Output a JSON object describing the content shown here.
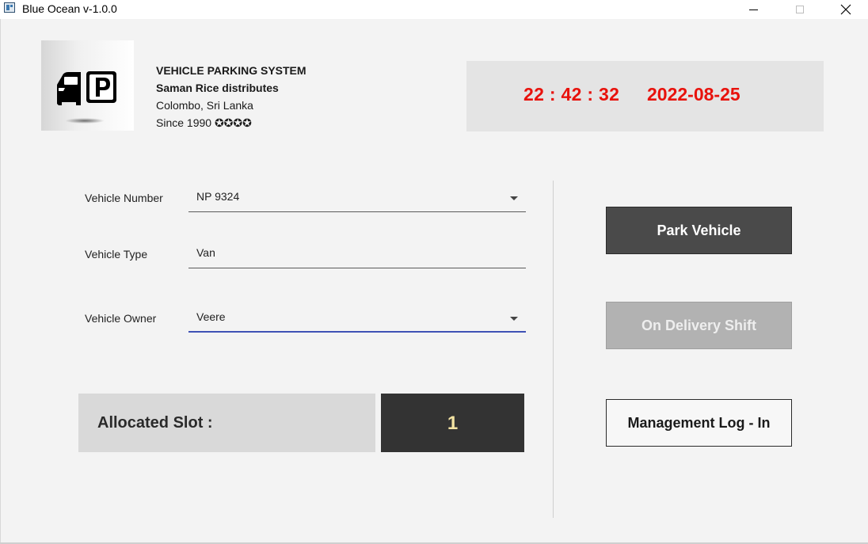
{
  "window": {
    "title": "Blue Ocean v-1.0.0"
  },
  "company": {
    "system_name": "VEHICLE PARKING SYSTEM",
    "name": "Saman Rice distributes",
    "location": "Colombo, Sri Lanka",
    "since": "Since 1990 ✪✪✪✪"
  },
  "clock": {
    "time": "22 : 42 : 32",
    "date": "2022-08-25",
    "color": "#e8120c"
  },
  "form": {
    "vehicle_number": {
      "label": "Vehicle Number",
      "value": "NP 9324"
    },
    "vehicle_type": {
      "label": "Vehicle Type",
      "value": "Van"
    },
    "vehicle_owner": {
      "label": "Vehicle Owner",
      "value": "Veere"
    }
  },
  "slot": {
    "label": "Allocated Slot :",
    "value": "1"
  },
  "buttons": {
    "park": "Park Vehicle",
    "delivery": "On Delivery Shift",
    "management": "Management Log - In"
  },
  "icons": {
    "logo": "car-parking-icon",
    "dropdown": "chevron-down-icon"
  },
  "colors": {
    "focus_underline": "#3f51b5",
    "park_button": "#4a4a4a",
    "disabled_button": "#b2b2b2"
  }
}
